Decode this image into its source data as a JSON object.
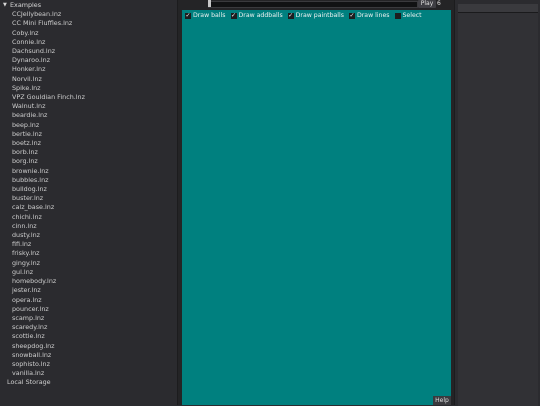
{
  "tree": {
    "root_label": "Examples",
    "items": [
      "CCJellybean.lnz",
      "CC Mini Fluffles.lnz",
      "Coby.lnz",
      "Connie.lnz",
      "Dachsund.lnz",
      "Dynaroo.lnz",
      "Honker.lnz",
      "Norvil.lnz",
      "Spike.lnz",
      "VPZ Gouldian Finch.lnz",
      "Walnut.lnz",
      "beardie.lnz",
      "beep.lnz",
      "bertie.lnz",
      "boetz.lnz",
      "borb.lnz",
      "borg.lnz",
      "brownie.lnz",
      "bubbles.lnz",
      "bulldog.lnz",
      "buster.lnz",
      "calz_base.lnz",
      "chichi.lnz",
      "cinn.lnz",
      "dusty.lnz",
      "fifi.lnz",
      "frisky.lnz",
      "gingy.lnz",
      "gul.lnz",
      "homebody.lnz",
      "jester.lnz",
      "opera.lnz",
      "pouncer.lnz",
      "scamp.lnz",
      "scaredy.lnz",
      "scottie.lnz",
      "sheepdog.lnz",
      "snowball.lnz",
      "sophisto.lnz",
      "vanilla.lnz"
    ],
    "bottom_label": "Local Storage"
  },
  "toolbar": {
    "play_label": "Play",
    "count": "6",
    "slider_position": 0
  },
  "options": {
    "draw_balls": {
      "label": "Draw balls",
      "checked": true
    },
    "draw_addballs": {
      "label": "Draw addballs",
      "checked": true
    },
    "draw_paintballs": {
      "label": "Draw paintballs",
      "checked": true
    },
    "draw_lines": {
      "label": "Draw lines",
      "checked": true
    },
    "select": {
      "label": "Select",
      "checked": false
    }
  },
  "help_label": "Help",
  "colors": {
    "canvas": "#00807f",
    "panel": "#2b2b2f"
  },
  "icons": {
    "tree_expand": "triangle-down-icon",
    "checkbox_check": "checkmark-icon"
  }
}
